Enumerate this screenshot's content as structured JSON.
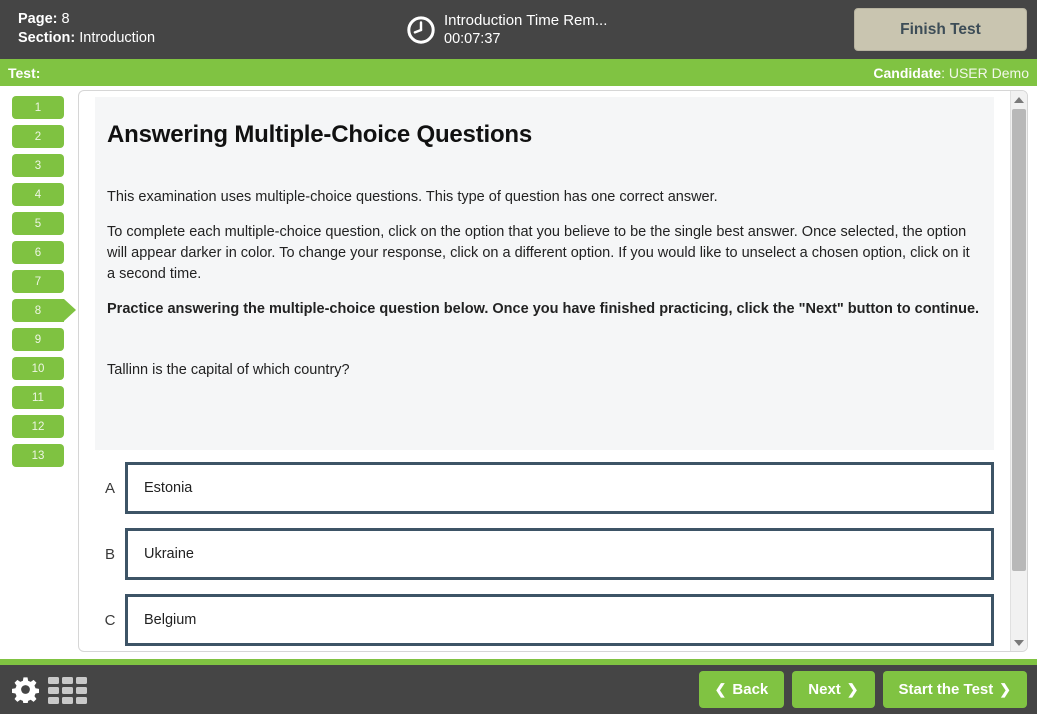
{
  "header": {
    "page_label": "Page:",
    "page_value": "8",
    "section_label": "Section:",
    "section_value": "Introduction",
    "timer_title": "Introduction Time Rem...",
    "timer_value": "00:07:37",
    "clock_icon": "clock-icon",
    "finish_button": "Finish Test"
  },
  "greenbar": {
    "test_label": "Test:",
    "candidate_label": "Candidate",
    "candidate_value": "USER Demo",
    "candidate_separator": ": "
  },
  "sidebar": {
    "items": [
      {
        "label": "1",
        "active": false
      },
      {
        "label": "2",
        "active": false
      },
      {
        "label": "3",
        "active": false
      },
      {
        "label": "4",
        "active": false
      },
      {
        "label": "5",
        "active": false
      },
      {
        "label": "6",
        "active": false
      },
      {
        "label": "7",
        "active": false
      },
      {
        "label": "8",
        "active": true
      },
      {
        "label": "9",
        "active": false
      },
      {
        "label": "10",
        "active": false
      },
      {
        "label": "11",
        "active": false
      },
      {
        "label": "12",
        "active": false
      },
      {
        "label": "13",
        "active": false
      }
    ]
  },
  "content": {
    "title": "Answering Multiple-Choice Questions",
    "paragraph1": "This examination uses multiple-choice questions. This type of question has one correct answer.",
    "paragraph2": "To complete each multiple-choice question, click on the option that you believe to be the single best answer. Once selected, the option will appear darker in color. To change your response, click on a different option. If you would like to unselect a chosen option, click on it a second time.",
    "paragraph3_bold": "Practice answering the multiple-choice question below. Once you have finished practicing, click the \"Next\" button to continue.",
    "question": "Tallinn is the capital of which country?",
    "options": [
      {
        "letter": "A",
        "text": "Estonia",
        "selected": false
      },
      {
        "letter": "B",
        "text": "Ukraine",
        "selected": false
      },
      {
        "letter": "C",
        "text": "Belgium",
        "selected": false
      }
    ]
  },
  "scrollbar": {
    "up_arrow_icon": "scroll-up-arrow-icon",
    "down_arrow_icon": "scroll-down-arrow-icon"
  },
  "footer": {
    "settings_icon": "gear-icon",
    "grid_icon": "grid-menu-icon",
    "back_button": "Back",
    "back_chevron": "❮",
    "next_button": "Next",
    "next_chevron": "❯",
    "start_button": "Start the Test",
    "start_chevron": "❯"
  },
  "colors": {
    "brand_green": "#80c342",
    "header_dark": "#454545",
    "finish_beige": "#c9c5b0",
    "option_border": "#3d5466",
    "panel_gray": "#f5f6f7"
  }
}
